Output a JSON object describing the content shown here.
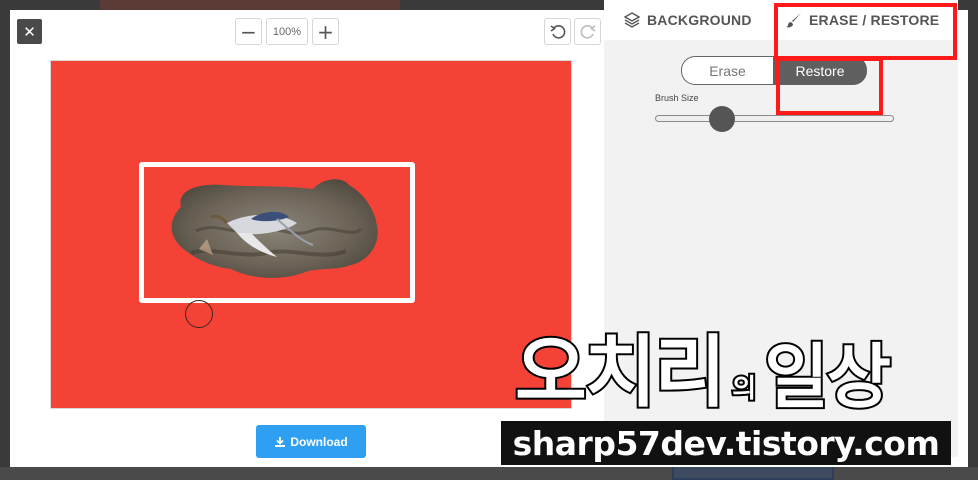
{
  "toolbar": {
    "close_icon": "close-icon",
    "zoom_out_label": "−",
    "zoom_value": "100%",
    "zoom_in_label": "+",
    "undo_icon": "undo-icon",
    "redo_icon": "redo-icon"
  },
  "tabs": [
    {
      "label": "BACKGROUND",
      "icon": "layers-icon"
    },
    {
      "label": "ERASE / RESTORE",
      "icon": "brush-icon",
      "active": true
    }
  ],
  "erase_restore": {
    "erase_label": "Erase",
    "restore_label": "Restore",
    "selected": "Restore",
    "brush_size_label": "Brush Size",
    "brush_size_fraction": 0.28
  },
  "download": {
    "label": "Download",
    "icon": "download-icon"
  },
  "colors": {
    "canvas_background": "#f44336",
    "accent_button": "#2f9ff2",
    "annotation": "#ff1a1a",
    "segment_active": "#5f5f5f"
  },
  "watermark": {
    "title_part1": "오치리",
    "title_small": "의",
    "title_part2": "일상",
    "url": "sharp57dev.tistory.com"
  }
}
